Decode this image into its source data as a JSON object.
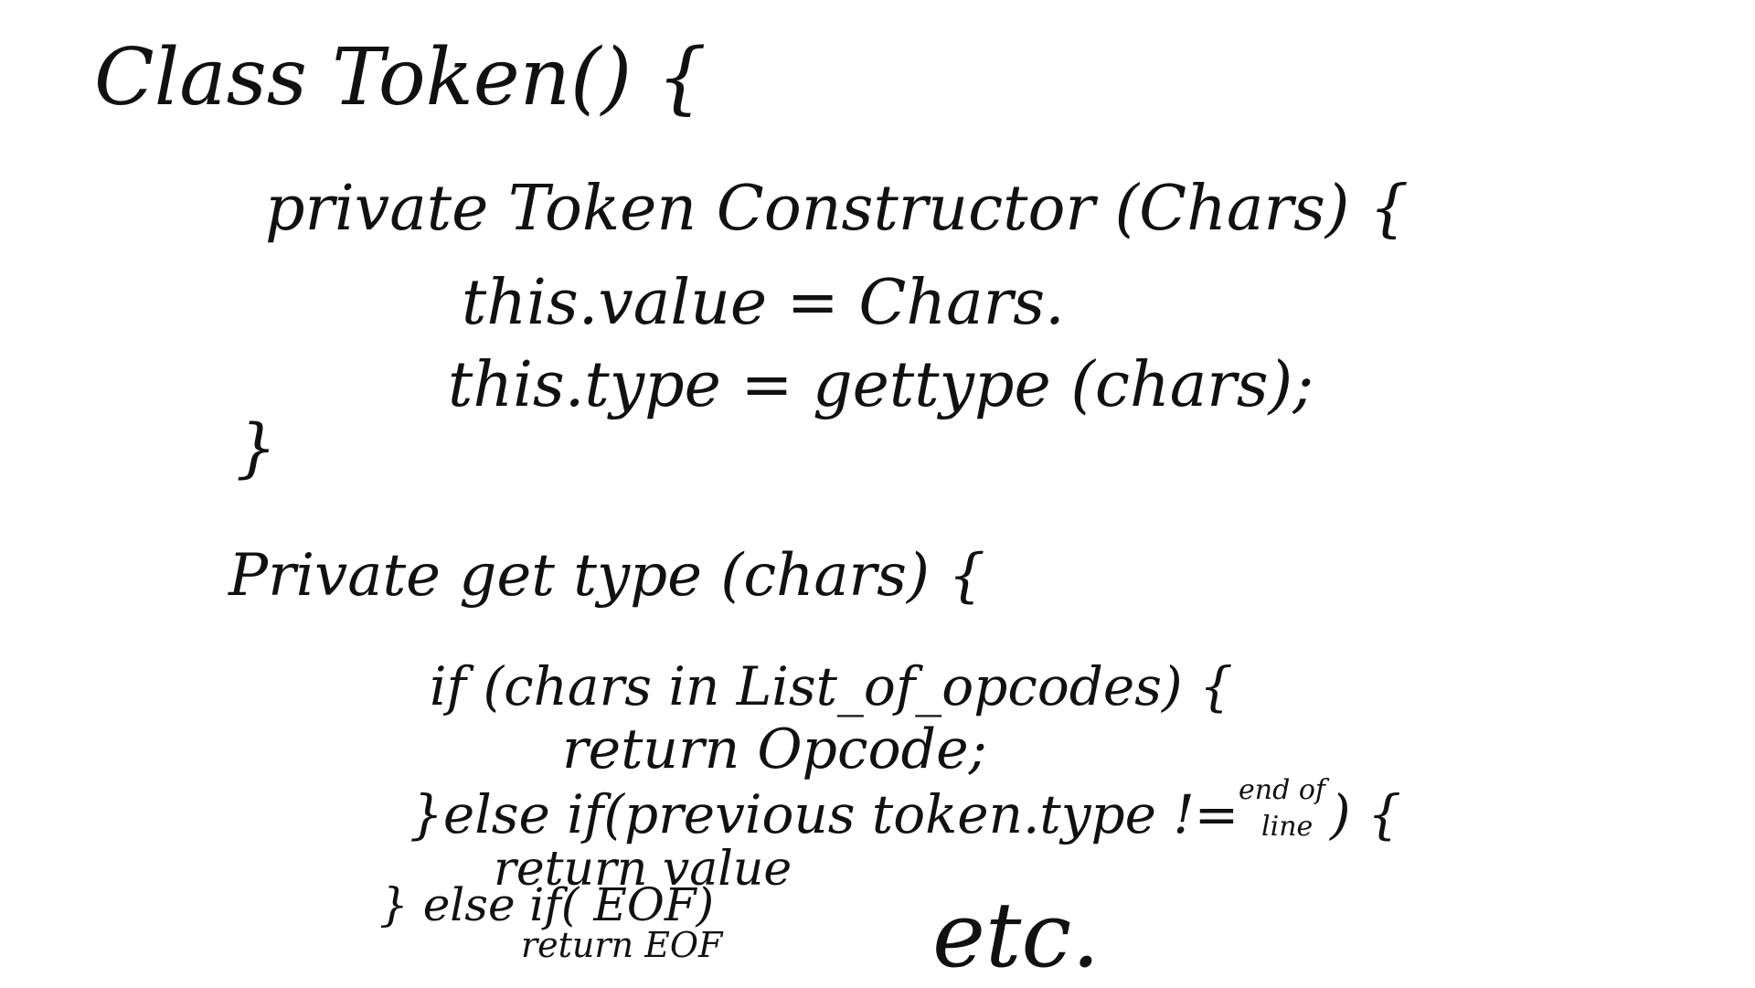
{
  "lines": [
    "Class Token() {",
    "private Token Constructor (Chars) {",
    "this.value = Chars.",
    "this.type = gettype (chars);",
    "}",
    "Private get type (chars) {",
    "if (chars in List_of_opcodes) {",
    "return Opcode;",
    "}else if(previous token.type != ",
    "end of",
    "line",
    ") {",
    "return value",
    "} else if( EOF)",
    "return EOF",
    "etc."
  ]
}
